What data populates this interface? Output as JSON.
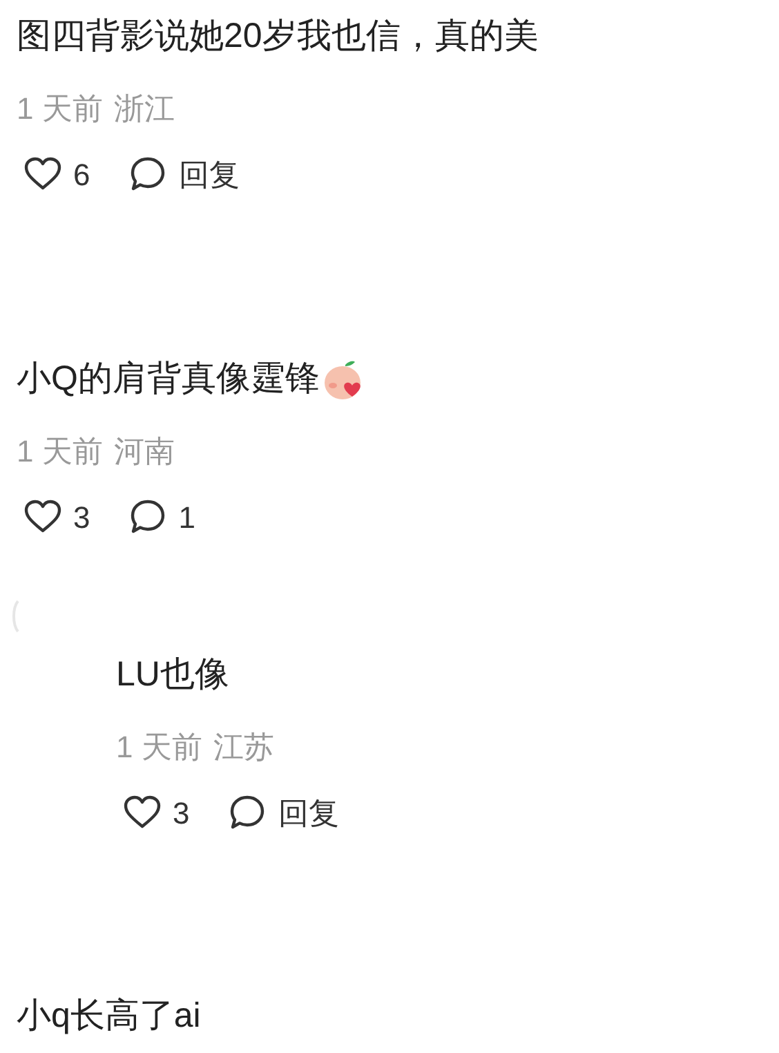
{
  "comments": [
    {
      "text": "图四背影说她20岁我也信，真的美",
      "time": "1 天前",
      "location": "浙江",
      "likes": "6",
      "reply_label": "回复"
    },
    {
      "text": "小Q的肩背真像霆锋",
      "emoji": true,
      "time": "1 天前",
      "location": "河南",
      "likes": "3",
      "reply_label": "1",
      "replies": [
        {
          "text": "LU也像",
          "time": "1 天前",
          "location": "江苏",
          "likes": "3",
          "reply_label": "回复"
        }
      ]
    },
    {
      "text": "小q长高了ai"
    }
  ]
}
